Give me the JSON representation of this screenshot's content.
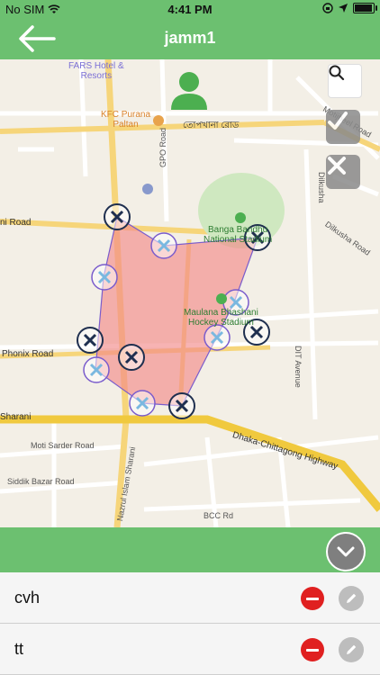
{
  "status_bar": {
    "carrier": "No SIM",
    "time": "4:41 PM",
    "icons": [
      "wifi-icon",
      "orientation-lock-icon",
      "location-icon",
      "battery-icon"
    ]
  },
  "nav": {
    "title": "jamm1",
    "back_icon": "back-arrow-icon"
  },
  "map": {
    "labels": {
      "hotel": "FARS Hotel &\nResorts",
      "kfc": "KFC Purana\nPaltan",
      "topkhana": "তোপখানা রোড",
      "gpo": "GPO Road",
      "motijheel": "Motijheel Road",
      "dilkusha": "Dilkusha",
      "dilkusha2": "Dilkusha Road",
      "road_left": "ni Road",
      "stadium": "Banga Bandhu\nNational Stadium",
      "hockey": "Maulana Bhashani\nHockey Stadium",
      "phonix": "Phonix Road",
      "dit": "DIT Avenue",
      "sharani": "Sharani",
      "highway": "Dhaka-Chittagong Highway",
      "moti_sarder": "Moti Sarder Road",
      "siddik": "Siddik Bazar Road",
      "bcc": "BCC Rd",
      "nazrul": "Nazrul Islam Sharani"
    },
    "buttons": {
      "search_icon": "search-icon",
      "confirm_icon": "check-icon",
      "cancel_icon": "close-icon"
    },
    "colors": {
      "polygon_fill": "#f28b8b",
      "polygon_stroke": "#7a5ccc",
      "marker_dark": "#1f2f4f",
      "marker_light": "#7ab8e0",
      "accent": "#6cc070"
    }
  },
  "footer": {
    "collapse_icon": "chevron-down-icon"
  },
  "list": [
    {
      "name": "cvh",
      "delete_icon": "minus-icon",
      "edit_icon": "pencil-icon"
    },
    {
      "name": "tt",
      "delete_icon": "minus-icon",
      "edit_icon": "pencil-icon"
    }
  ]
}
